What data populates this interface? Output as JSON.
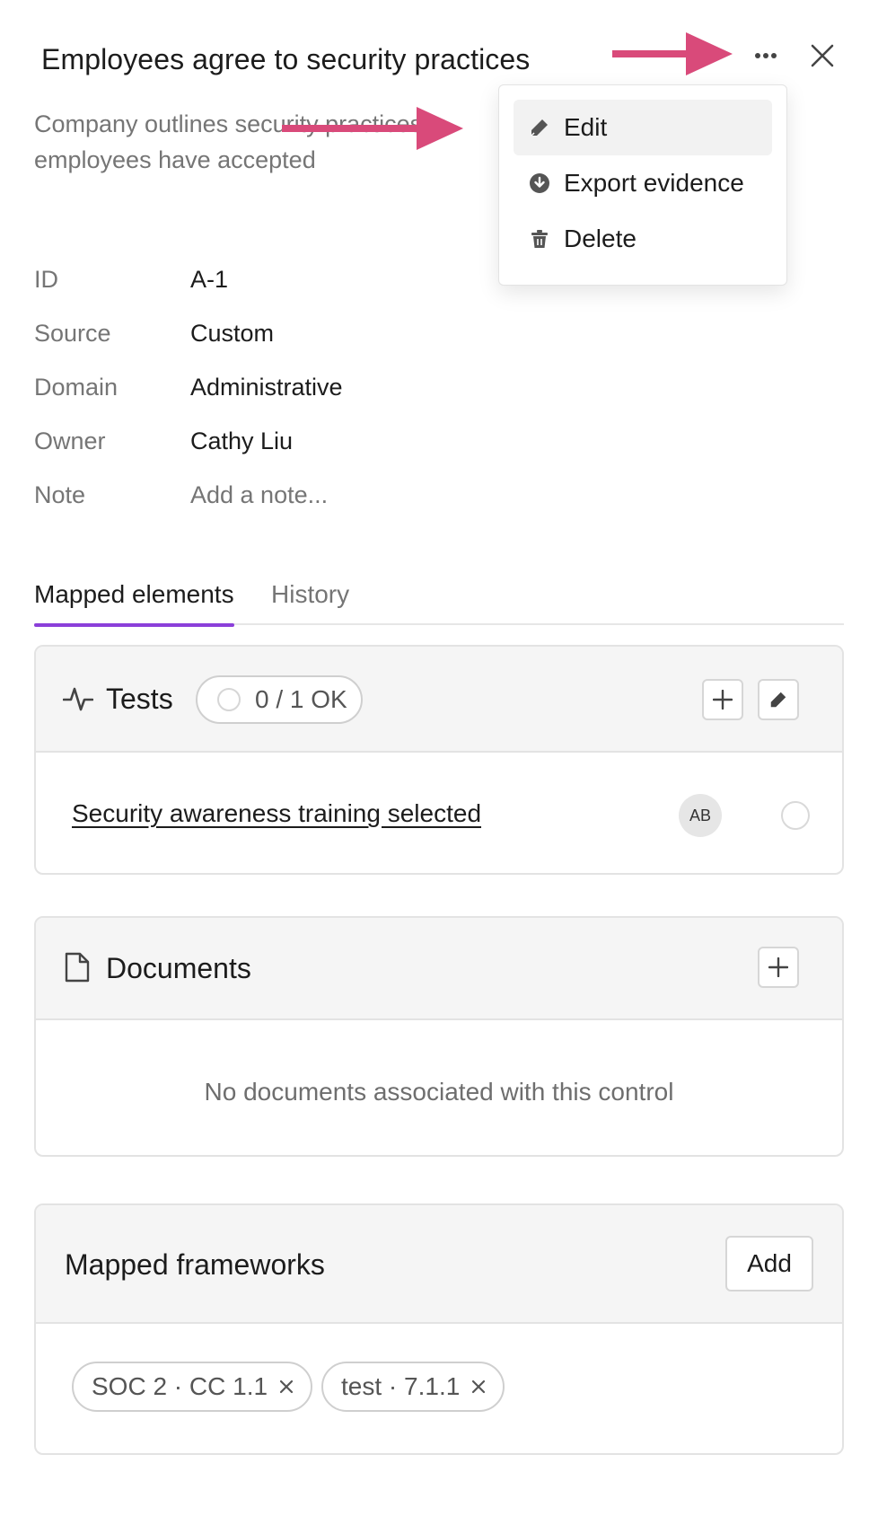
{
  "header": {
    "title": "Employees agree to security practices",
    "subtitle_line1": "Company outlines security practices in",
    "subtitle_line2": "employees have accepted"
  },
  "menu": {
    "items": [
      {
        "label": "Edit",
        "icon": "pencil-icon"
      },
      {
        "label": "Export evidence",
        "icon": "download-circle-icon"
      },
      {
        "label": "Delete",
        "icon": "trash-icon"
      }
    ]
  },
  "properties": [
    {
      "label": "ID",
      "value": "A-1"
    },
    {
      "label": "Source",
      "value": "Custom"
    },
    {
      "label": "Domain",
      "value": "Administrative"
    },
    {
      "label": "Owner",
      "value": "Cathy Liu"
    },
    {
      "label": "Note",
      "value": "Add a note..."
    }
  ],
  "tabs": [
    {
      "label": "Mapped elements",
      "active": true
    },
    {
      "label": "History",
      "active": false
    }
  ],
  "tests": {
    "title": "Tests",
    "status": "0 / 1 OK",
    "items": [
      {
        "name": "Security awareness training selected",
        "assignee": "AB"
      }
    ]
  },
  "documents": {
    "title": "Documents",
    "empty": "No documents associated with this control"
  },
  "frameworks": {
    "title": "Mapped frameworks",
    "add_label": "Add",
    "chips": [
      "SOC 2 · CC 1.1",
      "test · 7.1.1"
    ]
  },
  "colors": {
    "accent": "#8b3fd9",
    "annotation_arrow": "#d94a7a"
  }
}
